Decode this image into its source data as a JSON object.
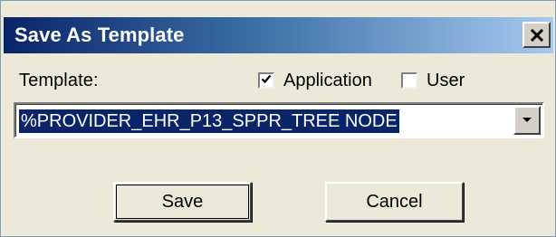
{
  "dialog": {
    "title": "Save As Template",
    "close_symbol": "✕"
  },
  "form": {
    "template_label": "Template:",
    "application_checkbox": {
      "label": "Application",
      "checked": true
    },
    "user_checkbox": {
      "label": "User",
      "checked": false
    },
    "template_value": "%PROVIDER_EHR_P13_SPPR_TREE NODE"
  },
  "buttons": {
    "save": "Save",
    "cancel": "Cancel"
  },
  "colors": {
    "title_start": "#0a246a",
    "title_end": "#a6caf0",
    "selection_bg": "#0a246a"
  },
  "icons": {
    "close": "close-icon",
    "checked": "checkmark-icon",
    "dropdown": "chevron-down-icon"
  }
}
